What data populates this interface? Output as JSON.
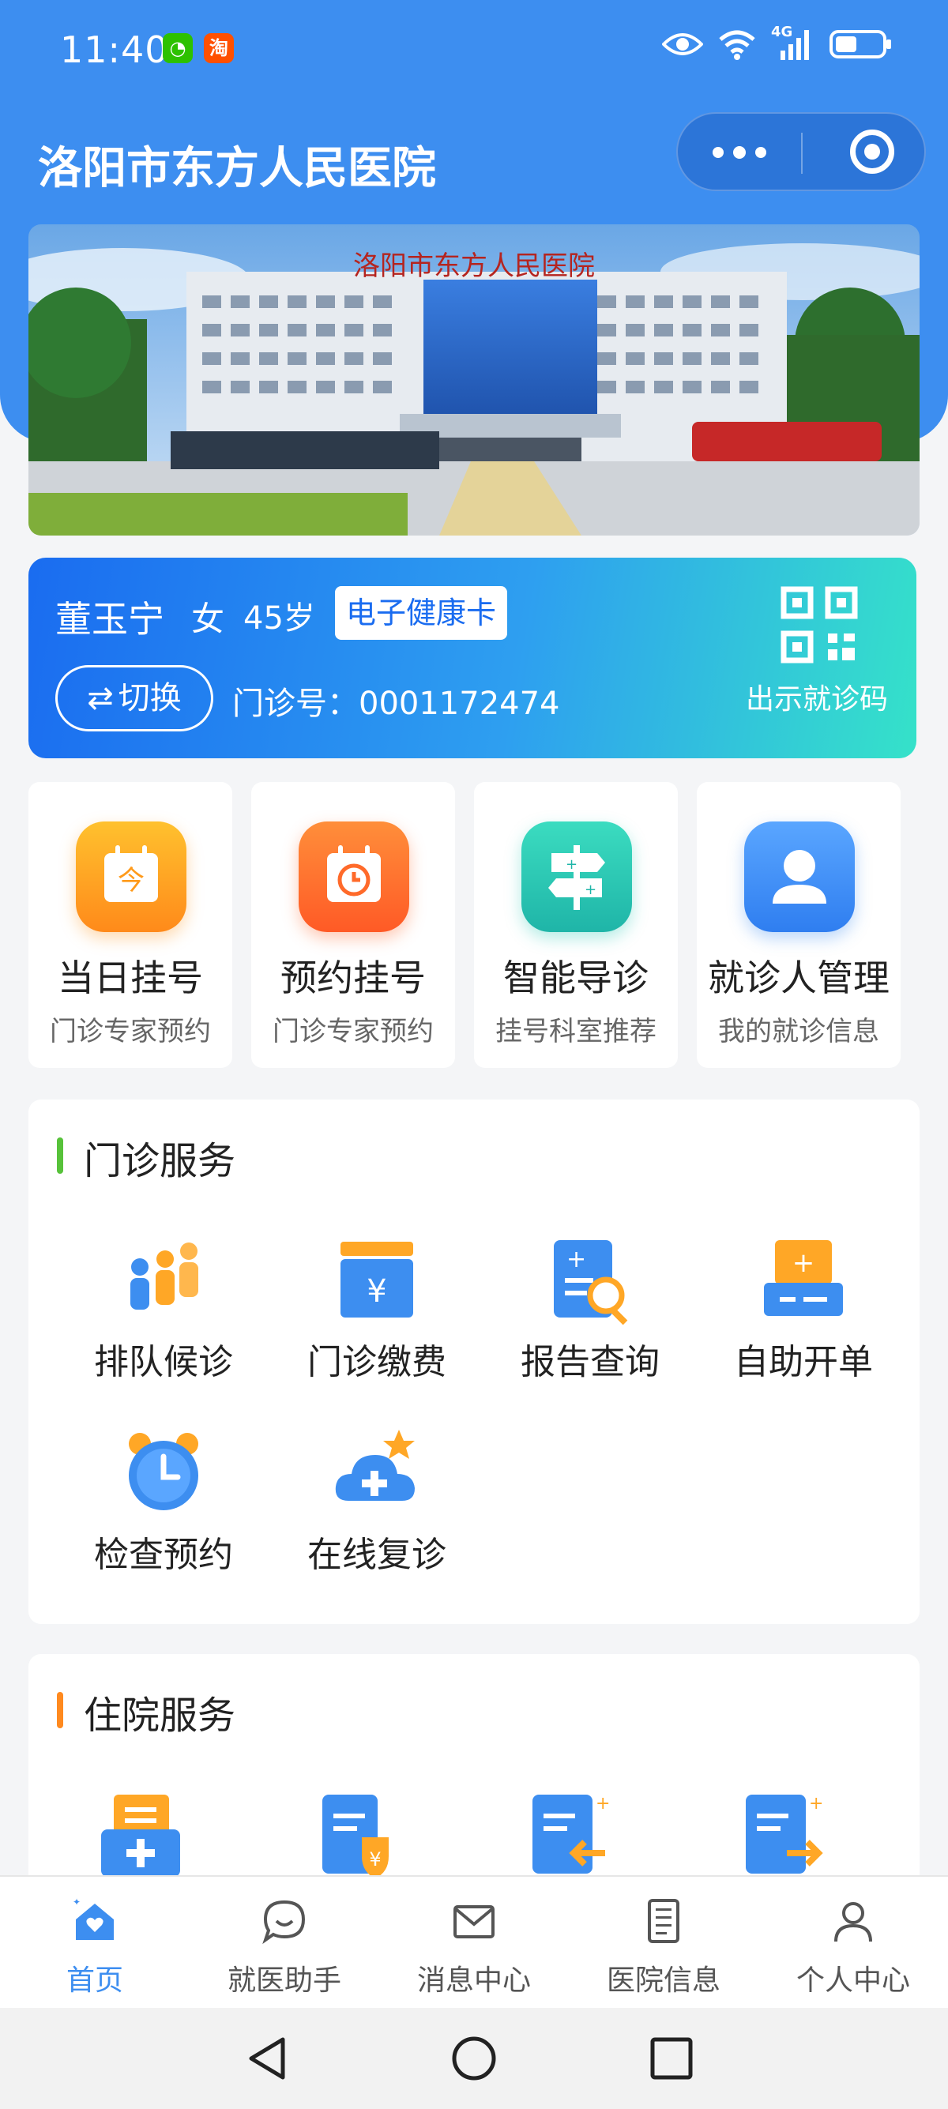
{
  "status": {
    "time": "11:40",
    "network": "4G"
  },
  "header": {
    "title": "洛阳市东方人民医院"
  },
  "banner": {
    "sign_text": "洛阳市东方人民医院"
  },
  "patient": {
    "name": "董玉宁",
    "gender": "女",
    "age": "45岁",
    "health_card_label": "电子健康卡",
    "switch_label": "切换",
    "outpatient_no": "门诊号：0001172474",
    "show_code_label": "出示就诊码"
  },
  "quick_actions": [
    {
      "title": "当日挂号",
      "subtitle": "门诊专家预约",
      "icon": "calendar-today-icon",
      "color": "#ff9f1a"
    },
    {
      "title": "预约挂号",
      "subtitle": "门诊专家预约",
      "icon": "calendar-clock-icon",
      "color": "#ff6b2a"
    },
    {
      "title": "智能导诊",
      "subtitle": "挂号科室推荐",
      "icon": "signpost-icon",
      "color": "#25c7b3"
    },
    {
      "title": "就诊人管理",
      "subtitle": "我的就诊信息",
      "icon": "user-icon",
      "color": "#3d8ef0"
    }
  ],
  "outpatient_services": {
    "title": "门诊服务",
    "items": [
      {
        "label": "排队候诊",
        "icon": "queue-people-icon"
      },
      {
        "label": "门诊缴费",
        "icon": "payment-yuan-icon"
      },
      {
        "label": "报告查询",
        "icon": "report-search-icon"
      },
      {
        "label": "自助开单",
        "icon": "self-order-icon"
      },
      {
        "label": "检查预约",
        "icon": "alarm-clock-icon"
      },
      {
        "label": "在线复诊",
        "icon": "cloud-plus-icon"
      }
    ]
  },
  "inpatient_services": {
    "title": "住院服务"
  },
  "tabbar": [
    {
      "label": "首页",
      "icon": "home-heart-icon",
      "active": true
    },
    {
      "label": "就医助手",
      "icon": "chat-smile-icon",
      "active": false
    },
    {
      "label": "消息中心",
      "icon": "mail-icon",
      "active": false
    },
    {
      "label": "医院信息",
      "icon": "document-icon",
      "active": false
    },
    {
      "label": "个人中心",
      "icon": "person-icon",
      "active": false
    }
  ],
  "colors": {
    "primary": "#3d8ef0",
    "green_bar": "#57c23a",
    "orange_bar": "#ff8a1f"
  }
}
